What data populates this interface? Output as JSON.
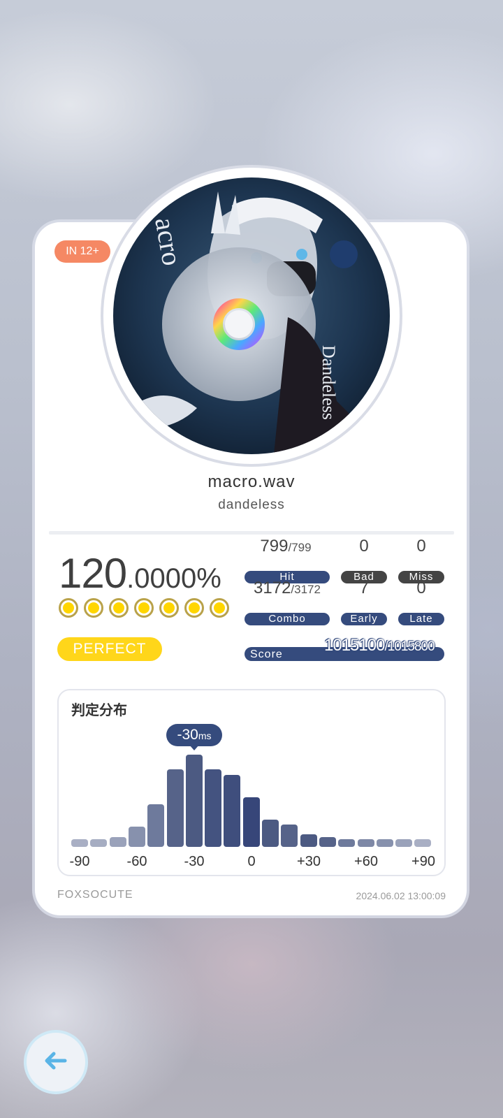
{
  "chart_info": {
    "level": "IN 12+",
    "title": "macro.wav",
    "artist": "dandeless"
  },
  "result": {
    "accuracy_int": "120",
    "accuracy_dec": ".0000%",
    "medal_count": 7,
    "grade": "PERFECT"
  },
  "stats": {
    "hit": {
      "value": "799",
      "total": "/799",
      "label": "Hit"
    },
    "bad": {
      "value": "0",
      "label": "Bad"
    },
    "miss": {
      "value": "0",
      "label": "Miss"
    },
    "combo": {
      "value": "3172",
      "total": "/3172",
      "label": "Combo"
    },
    "early": {
      "value": "7",
      "label": "Early"
    },
    "late": {
      "value": "0",
      "label": "Late"
    },
    "score": {
      "label": "Score",
      "value": "1015100",
      "total": "/1015800"
    }
  },
  "distribution": {
    "title": "判定分布",
    "tooltip_value": "-30",
    "tooltip_unit": "ms",
    "ticks": [
      "-90",
      "-60",
      "-30",
      "0",
      "+30",
      "+60",
      "+90"
    ]
  },
  "chart_data": {
    "type": "bar",
    "title": "判定分布",
    "x": [
      -90,
      -80,
      -70,
      -60,
      -50,
      -40,
      -30,
      -20,
      -10,
      0,
      10,
      20,
      30,
      40,
      50,
      60,
      70,
      80,
      90
    ],
    "values": [
      3,
      3,
      4,
      8,
      17,
      31,
      37,
      31,
      29,
      20,
      11,
      9,
      5,
      4,
      3,
      3,
      3,
      3,
      3
    ],
    "colors": [
      "#a9afc4",
      "#a6adc2",
      "#9aa2ba",
      "#8791ad",
      "#6e7a9c",
      "#566389",
      "#4c5a82",
      "#445380",
      "#3f4e7d",
      "#374679",
      "#4c5a82",
      "#566389",
      "#4c5a82",
      "#566389",
      "#6e7a9c",
      "#7e88a6",
      "#8791ad",
      "#9aa2ba",
      "#a9afc4"
    ],
    "xlabel": "",
    "ylabel": "",
    "highlight": "-30ms"
  },
  "footer": {
    "player": "FOXSOCUTE",
    "date": "2024.06.02 13:00:09"
  }
}
